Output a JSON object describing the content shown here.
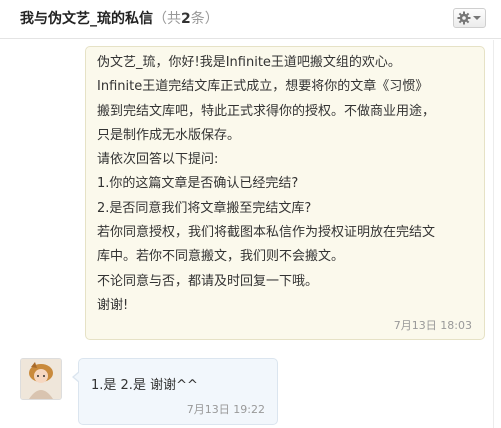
{
  "header": {
    "title_prefix": "我与",
    "contact_name": "伪文艺_琉",
    "title_suffix": "的私信",
    "count_open": "（共",
    "count_value": "2",
    "count_close": "条）",
    "settings_icon": "gear-icon"
  },
  "messages": [
    {
      "direction": "outgoing",
      "lines": [
        "伪文艺_琉，你好!我是Infinite王道吧搬文组的欢心。",
        "Infinite王道完结文库正式成立，想要将你的文章《习惯》",
        "搬到完结文库吧，特此正式求得你的授权。不做商业用途，",
        "只是制作成无水版保存。",
        "请依次回答以下提问:",
        "1.你的这篇文章是否确认已经完结?",
        "2.是否同意我们将文章搬至完结文库?",
        "若你同意授权，我们将截图本私信作为授权证明放在完结文",
        "库中。若你不同意搬文，我们则不会搬文。",
        "不论同意与否，都请及时回复一下哦。",
        "谢谢!"
      ],
      "time": "7月13日  18:03"
    },
    {
      "direction": "incoming",
      "text": "1.是 2.是 谢谢^^",
      "time": "7月13日  19:22"
    }
  ],
  "colors": {
    "outgoing_bubble": "#fbf9ec",
    "incoming_bubble": "#f2f7fc",
    "timestamp": "#999999"
  }
}
